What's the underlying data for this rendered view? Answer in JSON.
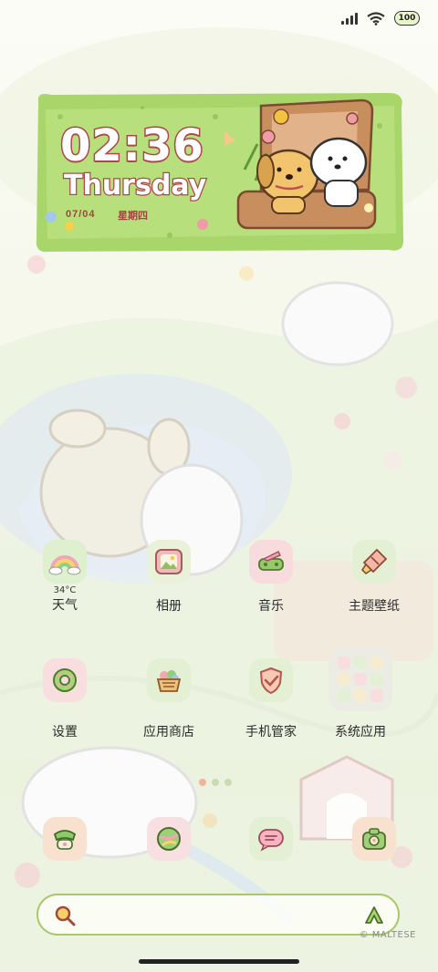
{
  "status_bar": {
    "battery_level": "100"
  },
  "clock_widget": {
    "time": "02:36",
    "day": "Thursday",
    "date": "07/04",
    "weekday_cn": "星期四"
  },
  "apps_row1": [
    {
      "label": "天气",
      "sub": "34°C",
      "icon": "rainbow-icon"
    },
    {
      "label": "相册",
      "icon": "photo-frame-icon"
    },
    {
      "label": "音乐",
      "icon": "music-icon"
    },
    {
      "label": "主题壁纸",
      "icon": "paintbrush-icon"
    }
  ],
  "apps_row2": [
    {
      "label": "设置",
      "icon": "gear-donut-icon"
    },
    {
      "label": "应用商店",
      "icon": "basket-icon"
    },
    {
      "label": "手机管家",
      "icon": "shield-icon"
    },
    {
      "label": "系统应用",
      "icon": "app-folder-icon"
    }
  ],
  "dock": [
    {
      "icon": "phone-icon"
    },
    {
      "icon": "browser-ball-icon"
    },
    {
      "icon": "message-icon"
    },
    {
      "icon": "camera-icon"
    }
  ],
  "watermark": "© MALTESE"
}
